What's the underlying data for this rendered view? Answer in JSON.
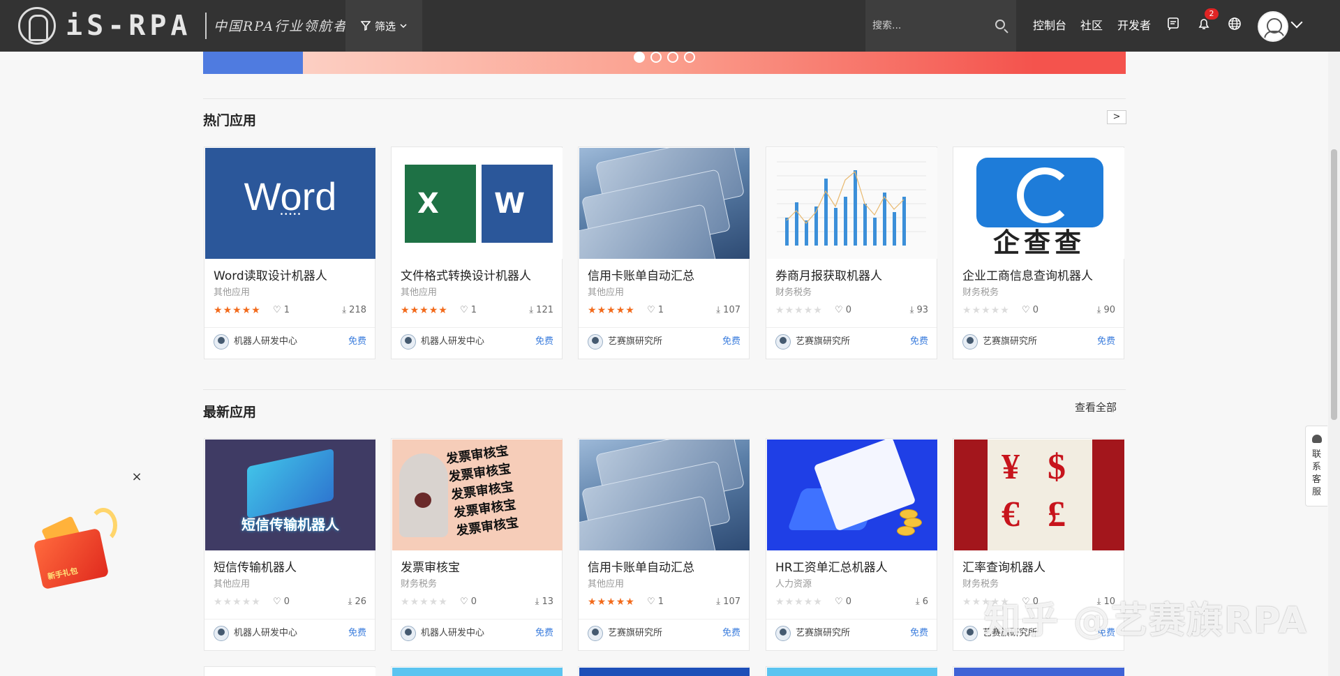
{
  "navbar": {
    "logo_text": "iS-RPA",
    "slogan": "中国RPA行业领航者",
    "filter_label": "筛选",
    "search_placeholder": "搜索...",
    "links": [
      "控制台",
      "社区",
      "开发者"
    ],
    "notification_count": "2",
    "icons": [
      "filter-icon",
      "search-icon",
      "message-icon",
      "bell-icon",
      "globe-icon",
      "avatar",
      "chevron-down-icon"
    ]
  },
  "sections": {
    "hot": {
      "title": "热门应用",
      "more_label": ">"
    },
    "latest": {
      "title": "最新应用",
      "more_label": "查看全部"
    }
  },
  "hot_apps": [
    {
      "title": "Word读取设计机器人",
      "category": "其他应用",
      "rating": 5,
      "likes": "1",
      "downloads": "218",
      "publisher": "机器人研发中心",
      "price": "免费",
      "thumb_text": "Word"
    },
    {
      "title": "文件格式转换设计机器人",
      "category": "其他应用",
      "rating": 5,
      "likes": "1",
      "downloads": "121",
      "publisher": "机器人研发中心",
      "price": "免费",
      "thumb_text": "X W"
    },
    {
      "title": "信用卡账单自动汇总",
      "category": "其他应用",
      "rating": 5,
      "likes": "1",
      "downloads": "107",
      "publisher": "艺赛旗研究所",
      "price": "免费"
    },
    {
      "title": "券商月报获取机器人",
      "category": "财务税务",
      "rating": 0,
      "likes": "0",
      "downloads": "93",
      "publisher": "艺赛旗研究所",
      "price": "免费"
    },
    {
      "title": "企业工商信息查询机器人",
      "category": "财务税务",
      "rating": 0,
      "likes": "0",
      "downloads": "90",
      "publisher": "艺赛旗研究所",
      "price": "免费",
      "thumb_text": "企查查"
    }
  ],
  "latest_apps": [
    {
      "title": "短信传输机器人",
      "category": "其他应用",
      "rating": 0,
      "likes": "0",
      "downloads": "26",
      "publisher": "机器人研发中心",
      "price": "免费",
      "thumb_text": "短信传输机器人"
    },
    {
      "title": "发票审核宝",
      "category": "财务税务",
      "rating": 0,
      "likes": "0",
      "downloads": "13",
      "publisher": "机器人研发中心",
      "price": "免费",
      "thumb_text": "发票审核宝 发票审核宝 发票审核宝 发票审核宝 发票审核宝"
    },
    {
      "title": "信用卡账单自动汇总",
      "category": "其他应用",
      "rating": 5,
      "likes": "1",
      "downloads": "107",
      "publisher": "艺赛旗研究所",
      "price": "免费"
    },
    {
      "title": "HR工资单汇总机器人",
      "category": "人力资源",
      "rating": 0,
      "likes": "0",
      "downloads": "6",
      "publisher": "艺赛旗研究所",
      "price": "免费"
    },
    {
      "title": "汇率查询机器人",
      "category": "财务税务",
      "rating": 0,
      "likes": "0",
      "downloads": "10",
      "publisher": "艺赛旗研究所",
      "price": "免费",
      "thumb_text": "¥ $ € £"
    }
  ],
  "gift_widget": {
    "label": "新手礼包",
    "close_label": "×"
  },
  "customer_service": {
    "label": "联系客服"
  },
  "watermark": "知乎 @艺赛旗RPA",
  "colors": {
    "navbar": "#333333",
    "accent_star": "#f26a1b",
    "price_blue": "#3b7ddd",
    "badge_red": "#e02424"
  }
}
